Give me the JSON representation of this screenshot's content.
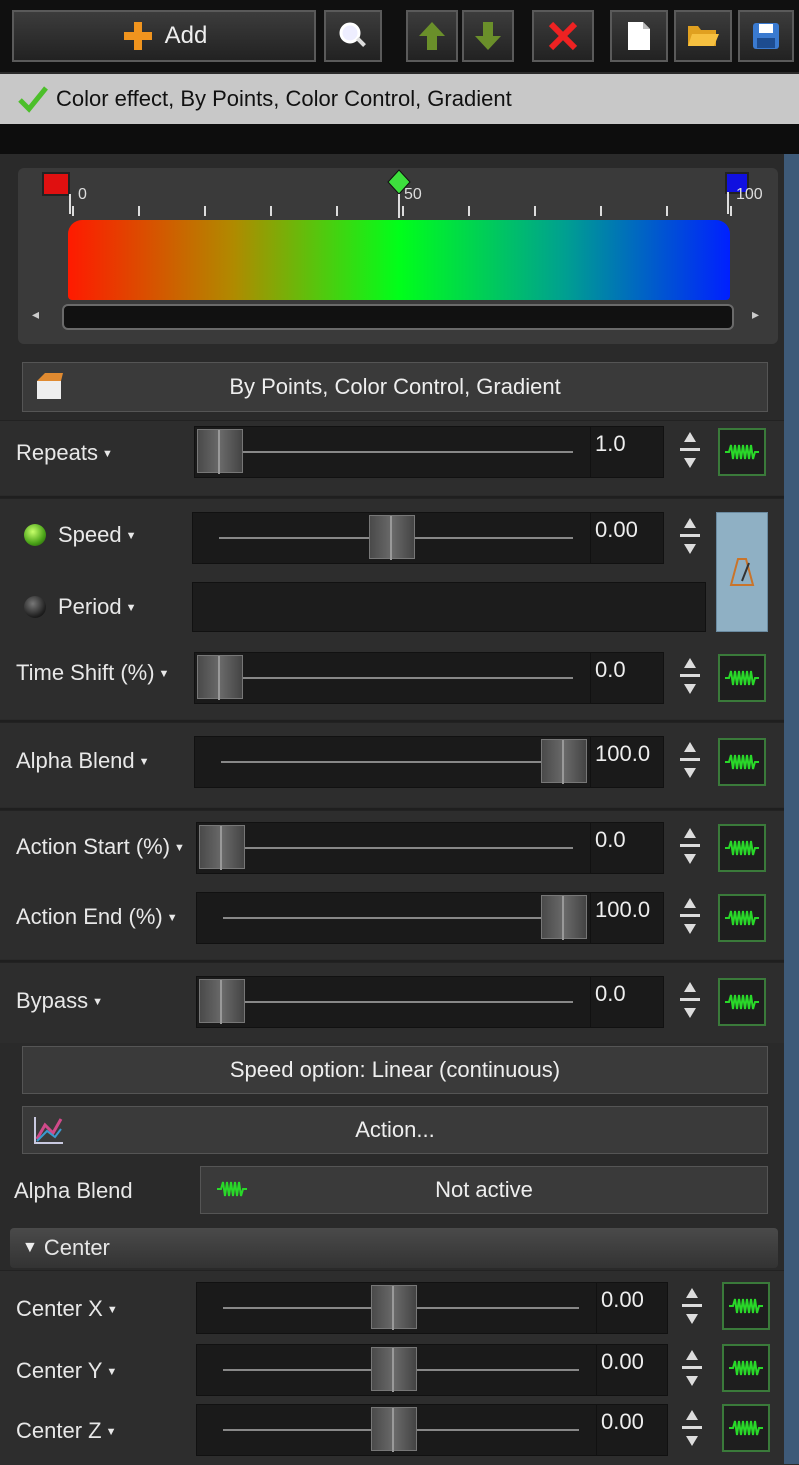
{
  "toolbar": {
    "add_label": "Add",
    "icons": [
      "search-icon",
      "arrow-up-icon",
      "arrow-down-icon",
      "delete-icon",
      "new-file-icon",
      "open-folder-icon",
      "save-icon"
    ]
  },
  "status": {
    "text": "Color effect, By Points, Color Control, Gradient"
  },
  "gradient": {
    "tick_labels": [
      "0",
      "50",
      "100"
    ],
    "colors": [
      "#ff1a00",
      "#00ff1a",
      "#0020ff"
    ]
  },
  "mode_button": {
    "label": "By Points, Color Control, Gradient"
  },
  "params": {
    "repeats": {
      "label": "Repeats",
      "value": "1.0"
    },
    "speed": {
      "label": "Speed",
      "value": "0.00"
    },
    "period": {
      "label": "Period"
    },
    "time_shift": {
      "label": "Time Shift (%)",
      "value": "0.0"
    },
    "alpha_blend": {
      "label": "Alpha Blend",
      "value": "100.0"
    },
    "action_start": {
      "label": "Action Start (%)",
      "value": "0.0"
    },
    "action_end": {
      "label": "Action End (%)",
      "value": "100.0"
    },
    "bypass": {
      "label": "Bypass",
      "value": "0.0"
    }
  },
  "speed_option": {
    "label": "Speed option: Linear (continuous)"
  },
  "action": {
    "label": "Action..."
  },
  "alpha_blend_status": {
    "label": "Alpha Blend",
    "state": "Not active"
  },
  "center": {
    "section_label": "Center",
    "x": {
      "label": "Center X",
      "value": "0.00"
    },
    "y": {
      "label": "Center Y",
      "value": "0.00"
    },
    "z": {
      "label": "Center Z",
      "value": "0.00"
    }
  },
  "colors": {
    "accent_green": "#3a7a3a",
    "status_bg": "#c8c8c8",
    "side_strip": "#3e5a78"
  }
}
